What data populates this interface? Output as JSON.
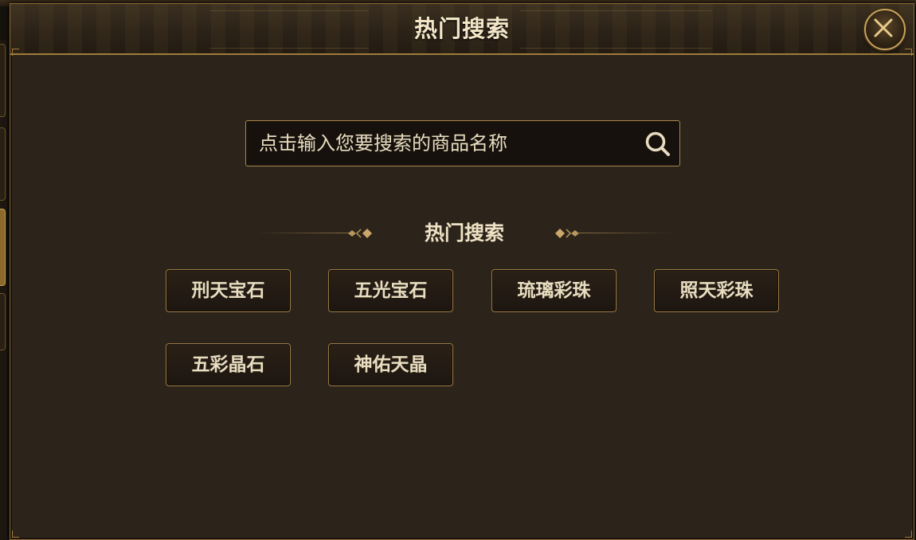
{
  "dialog": {
    "title": "热门搜索",
    "close_icon": "close-x-icon"
  },
  "search": {
    "placeholder": "点击输入您要搜索的商品名称",
    "value": "",
    "icon": "search-icon"
  },
  "hot_section": {
    "title": "热门搜索",
    "tags": [
      "刑天宝石",
      "五光宝石",
      "琉璃彩珠",
      "照天彩珠",
      "五彩晶石",
      "神佑天晶"
    ]
  },
  "colors": {
    "panel_bg": "#2c241b",
    "gold_border": "#a07c3c",
    "text_light": "#efe2c4"
  }
}
